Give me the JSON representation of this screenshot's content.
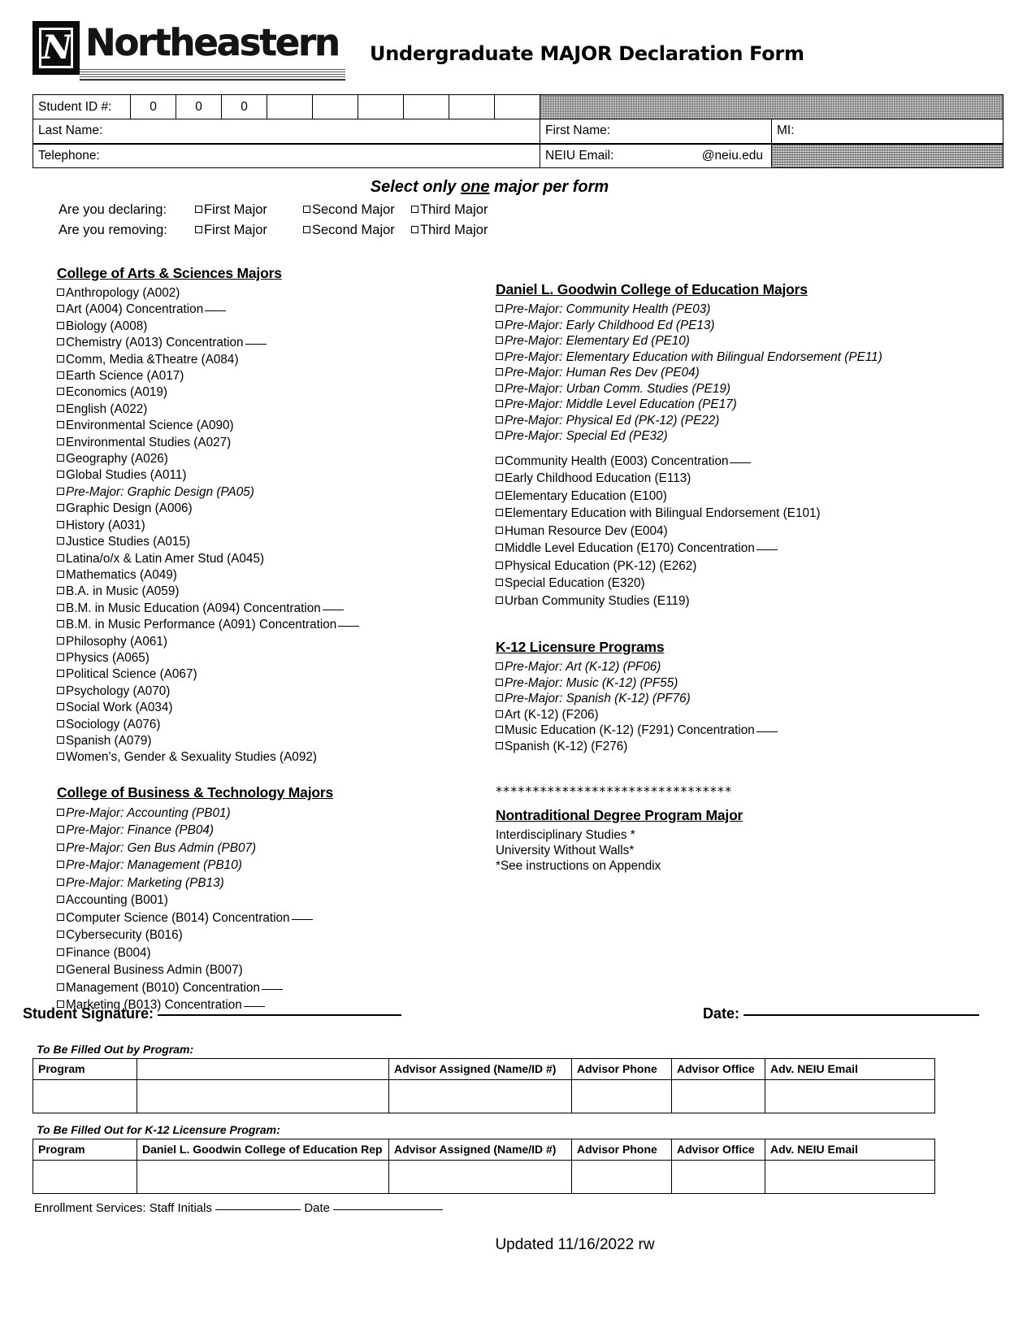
{
  "header": {
    "logo_word": "Northeastern",
    "logo_mark": "N",
    "doc_title": "Undergraduate MAJOR Declaration Form"
  },
  "info": {
    "student_id_label": "Student ID #:",
    "student_id_digits": [
      "0",
      "0",
      "0",
      "",
      "",
      "",
      "",
      "",
      ""
    ],
    "last_name_label": "Last Name:",
    "first_name_label": "First Name:",
    "mi_label": "MI:",
    "telephone_label": "Telephone:",
    "neiu_email_label": "NEIU Email:",
    "email_suffix": "@neiu.edu"
  },
  "select_one": {
    "prefix": "Select only ",
    "emphasis": "one",
    "suffix": " major per form"
  },
  "declaring": {
    "label": "Are you declaring:",
    "options": [
      "First Major",
      "Second Major",
      "Third Major"
    ]
  },
  "removing": {
    "label": "Are you removing:",
    "options": [
      "First Major",
      "Second Major",
      "Third Major"
    ]
  },
  "arts_sciences": {
    "heading": "College of Arts & Sciences Majors",
    "items": [
      {
        "text": "Anthropology (A002)",
        "italic": false,
        "blank": false
      },
      {
        "text": "Art (A004) Concentration",
        "italic": false,
        "blank": true
      },
      {
        "text": "Biology (A008)",
        "italic": false,
        "blank": false
      },
      {
        "text": "Chemistry (A013) Concentration",
        "italic": false,
        "blank": true
      },
      {
        "text": "Comm, Media &Theatre (A084)",
        "italic": false,
        "blank": false
      },
      {
        "text": "Earth Science (A017)",
        "italic": false,
        "blank": false
      },
      {
        "text": "Economics (A019)",
        "italic": false,
        "blank": false
      },
      {
        "text": "English (A022)",
        "italic": false,
        "blank": false
      },
      {
        "text": "Environmental Science (A090)",
        "italic": false,
        "blank": false
      },
      {
        "text": "Environmental Studies (A027)",
        "italic": false,
        "blank": false
      },
      {
        "text": "Geography (A026)",
        "italic": false,
        "blank": false
      },
      {
        "text": "Global Studies (A011)",
        "italic": false,
        "blank": false
      },
      {
        "text": "Pre-Major: Graphic Design (PA05)",
        "italic": true,
        "blank": false
      },
      {
        "text": "Graphic Design (A006)",
        "italic": false,
        "blank": false
      },
      {
        "text": "History (A031)",
        "italic": false,
        "blank": false
      },
      {
        "text": "Justice Studies (A015)",
        "italic": false,
        "blank": false
      },
      {
        "text": "Latina/o/x & Latin Amer Stud (A045)",
        "italic": false,
        "blank": false
      },
      {
        "text": "Mathematics (A049)",
        "italic": false,
        "blank": false
      },
      {
        "text": "B.A. in Music (A059)",
        "italic": false,
        "blank": false
      },
      {
        "text": "B.M. in Music Education (A094) Concentration",
        "italic": false,
        "blank": true
      },
      {
        "text": "B.M. in Music Performance (A091) Concentration",
        "italic": false,
        "blank": true
      },
      {
        "text": "Philosophy (A061)",
        "italic": false,
        "blank": false
      },
      {
        "text": "Physics (A065)",
        "italic": false,
        "blank": false
      },
      {
        "text": "Political Science (A067)",
        "italic": false,
        "blank": false
      },
      {
        "text": "Psychology (A070)",
        "italic": false,
        "blank": false
      },
      {
        "text": "Social Work (A034)",
        "italic": false,
        "blank": false
      },
      {
        "text": "Sociology (A076)",
        "italic": false,
        "blank": false
      },
      {
        "text": "Spanish (A079)",
        "italic": false,
        "blank": false
      },
      {
        "text": "Women’s, Gender & Sexuality Studies (A092)",
        "italic": false,
        "blank": false
      }
    ]
  },
  "business_technology": {
    "heading": "College of Business & Technology Majors",
    "items": [
      {
        "text": "Pre-Major: Accounting (PB01)",
        "italic": true,
        "blank": false
      },
      {
        "text": "Pre-Major: Finance (PB04)",
        "italic": true,
        "blank": false
      },
      {
        "text": "Pre-Major: Gen Bus Admin (PB07)",
        "italic": true,
        "blank": false
      },
      {
        "text": "Pre-Major: Management (PB10)",
        "italic": true,
        "blank": false
      },
      {
        "text": "Pre-Major: Marketing (PB13)",
        "italic": true,
        "blank": false
      },
      {
        "text": "Accounting (B001)",
        "italic": false,
        "blank": false
      },
      {
        "text": "Computer Science (B014) Concentration",
        "italic": false,
        "blank": true
      },
      {
        "text": "Cybersecurity (B016)",
        "italic": false,
        "blank": false
      },
      {
        "text": "Finance (B004)",
        "italic": false,
        "blank": false
      },
      {
        "text": "General Business Admin (B007)",
        "italic": false,
        "blank": false
      },
      {
        "text": "Management (B010) Concentration",
        "italic": false,
        "blank": true
      },
      {
        "text": "Marketing (B013) Concentration",
        "italic": false,
        "blank": true
      }
    ]
  },
  "education": {
    "heading": "Daniel L. Goodwin College of Education Majors",
    "pre_majors": [
      {
        "text": "Pre-Major: Community Health (PE03)",
        "italic": true,
        "blank": false
      },
      {
        "text": "Pre-Major: Early Childhood Ed (PE13)",
        "italic": true,
        "blank": false
      },
      {
        "text": "Pre-Major: Elementary Ed (PE10)",
        "italic": true,
        "blank": false
      },
      {
        "text": "Pre-Major: Elementary Education with Bilingual Endorsement (PE11)",
        "italic": true,
        "blank": false
      },
      {
        "text": "Pre-Major: Human Res Dev (PE04)",
        "italic": true,
        "blank": false
      },
      {
        "text": "Pre-Major: Urban Comm. Studies (PE19)",
        "italic": true,
        "blank": false
      },
      {
        "text": "Pre-Major: Middle Level Education (PE17)",
        "italic": true,
        "blank": false
      },
      {
        "text": "Pre-Major: Physical Ed (PK-12) (PE22)",
        "italic": true,
        "blank": false
      },
      {
        "text": "Pre-Major: Special Ed (PE32)",
        "italic": true,
        "blank": false
      }
    ],
    "majors": [
      {
        "text": "Community Health (E003) Concentration",
        "italic": false,
        "blank": true
      },
      {
        "text": "Early Childhood Education (E113)",
        "italic": false,
        "blank": false
      },
      {
        "text": "Elementary Education (E100)",
        "italic": false,
        "blank": false
      },
      {
        "text": "Elementary Education with Bilingual Endorsement (E101)",
        "italic": false,
        "blank": false
      },
      {
        "text": "Human Resource Dev (E004)",
        "italic": false,
        "blank": false
      },
      {
        "text": "Middle Level Education (E170) Concentration",
        "italic": false,
        "blank": true
      },
      {
        "text": "Physical Education (PK-12) (E262)",
        "italic": false,
        "blank": false
      },
      {
        "text": "Special Education (E320)",
        "italic": false,
        "blank": false
      },
      {
        "text": "Urban Community Studies (E119)",
        "italic": false,
        "blank": false
      }
    ]
  },
  "k12": {
    "heading": "K-12 Licensure Programs",
    "items": [
      {
        "text": "Pre-Major: Art (K-12) (PF06)",
        "italic": true,
        "blank": false
      },
      {
        "text": "Pre-Major: Music (K-12) (PF55)",
        "italic": true,
        "blank": false
      },
      {
        "text": "Pre-Major: Spanish (K-12) (PF76)",
        "italic": true,
        "blank": false
      },
      {
        "text": "Art (K-12) (F206)",
        "italic": false,
        "blank": false
      },
      {
        "text": "Music Education (K-12) (F291) Concentration",
        "italic": false,
        "blank": true
      },
      {
        "text": "Spanish (K-12) (F276)",
        "italic": false,
        "blank": false
      }
    ]
  },
  "nontraditional": {
    "divider": "********************************",
    "heading": "Nontraditional Degree Program Major",
    "lines": [
      "Interdisciplinary Studies *",
      "University Without Walls*",
      "*See instructions on Appendix"
    ]
  },
  "signature": {
    "student_label": "Student Signature:",
    "date_label": "Date:"
  },
  "program_table": {
    "caption": "To Be Filled Out by Program:",
    "headers": [
      "Program",
      "",
      "Advisor Assigned (Name/ID #)",
      "Advisor Phone",
      "Advisor Office",
      "Adv. NEIU Email"
    ]
  },
  "k12_table": {
    "caption": "To Be Filled Out for K-12 Licensure Program:",
    "headers": [
      "Program",
      "Daniel L. Goodwin College of Education Rep",
      "Advisor Assigned (Name/ID #)",
      "Advisor Phone",
      "Advisor Office",
      "Adv. NEIU Email"
    ]
  },
  "enrollment": {
    "prefix": "Enrollment Services: Staff Initials",
    "date_label": "Date"
  },
  "footer": {
    "updated": "Updated 11/16/2022 rw"
  }
}
